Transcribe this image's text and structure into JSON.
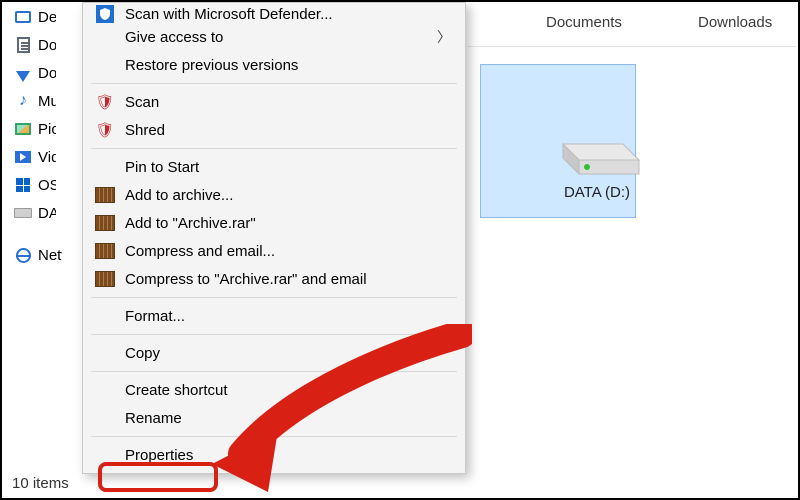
{
  "header": {
    "tabs": [
      "Documents",
      "Downloads"
    ]
  },
  "sidebar": {
    "items": [
      {
        "icon": "monitor-icon",
        "label": "Desktop"
      },
      {
        "icon": "document-icon",
        "label": "Documents"
      },
      {
        "icon": "download-icon",
        "label": "Downloads"
      },
      {
        "icon": "music-icon",
        "label": "Music"
      },
      {
        "icon": "picture-icon",
        "label": "Pictures"
      },
      {
        "icon": "video-icon",
        "label": "Videos"
      },
      {
        "icon": "os-drive-icon",
        "label": "OS (C:)"
      },
      {
        "icon": "drive-icon",
        "label": "DATA (D:)"
      },
      {
        "icon": "network-icon",
        "label": "Network"
      }
    ]
  },
  "drive": {
    "label": "DATA (D:)"
  },
  "context_menu": {
    "groups": [
      [
        {
          "icon": "defender-icon",
          "label": "Scan with Microsoft Defender...",
          "partial": true
        },
        {
          "icon": null,
          "label": "Give access to",
          "submenu": true
        },
        {
          "icon": null,
          "label": "Restore previous versions"
        }
      ],
      [
        {
          "icon": "mcafee-icon",
          "label": "Scan"
        },
        {
          "icon": "mcafee-icon",
          "label": "Shred"
        }
      ],
      [
        {
          "icon": null,
          "label": "Pin to Start"
        },
        {
          "icon": "winrar-icon",
          "label": "Add to archive..."
        },
        {
          "icon": "winrar-icon",
          "label": "Add to \"Archive.rar\""
        },
        {
          "icon": "winrar-icon",
          "label": "Compress and email..."
        },
        {
          "icon": "winrar-icon",
          "label": "Compress to \"Archive.rar\" and email"
        }
      ],
      [
        {
          "icon": null,
          "label": "Format..."
        }
      ],
      [
        {
          "icon": null,
          "label": "Copy"
        }
      ],
      [
        {
          "icon": null,
          "label": "Create shortcut"
        },
        {
          "icon": null,
          "label": "Rename"
        }
      ],
      [
        {
          "icon": null,
          "label": "Properties"
        }
      ]
    ]
  },
  "status": {
    "text": "10 items"
  },
  "annotation": {
    "highlight_target": "Properties"
  }
}
